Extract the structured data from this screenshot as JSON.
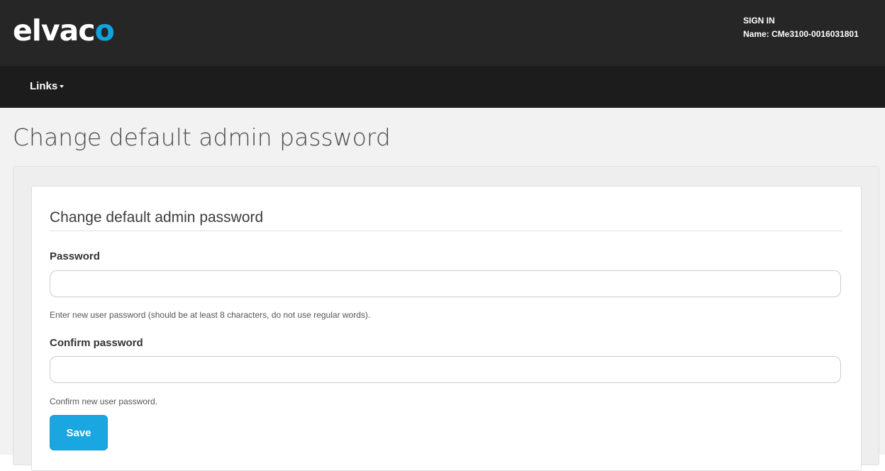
{
  "header": {
    "logo_text": "elvac",
    "logo_accent_letter": "o",
    "brand_accent_color": "#0fa3e0",
    "sign_in_label": "SIGN IN",
    "device_name": "Name: CMe3100-0016031801"
  },
  "navbar": {
    "links_label": "Links"
  },
  "page": {
    "title": "Change default admin password"
  },
  "form": {
    "legend": "Change default admin password",
    "password": {
      "label": "Password",
      "value": "",
      "help": "Enter new user password (should be at least 8 characters, do not use regular words)."
    },
    "confirm_password": {
      "label": "Confirm password",
      "value": "",
      "help": "Confirm new user password."
    },
    "save_label": "Save"
  }
}
